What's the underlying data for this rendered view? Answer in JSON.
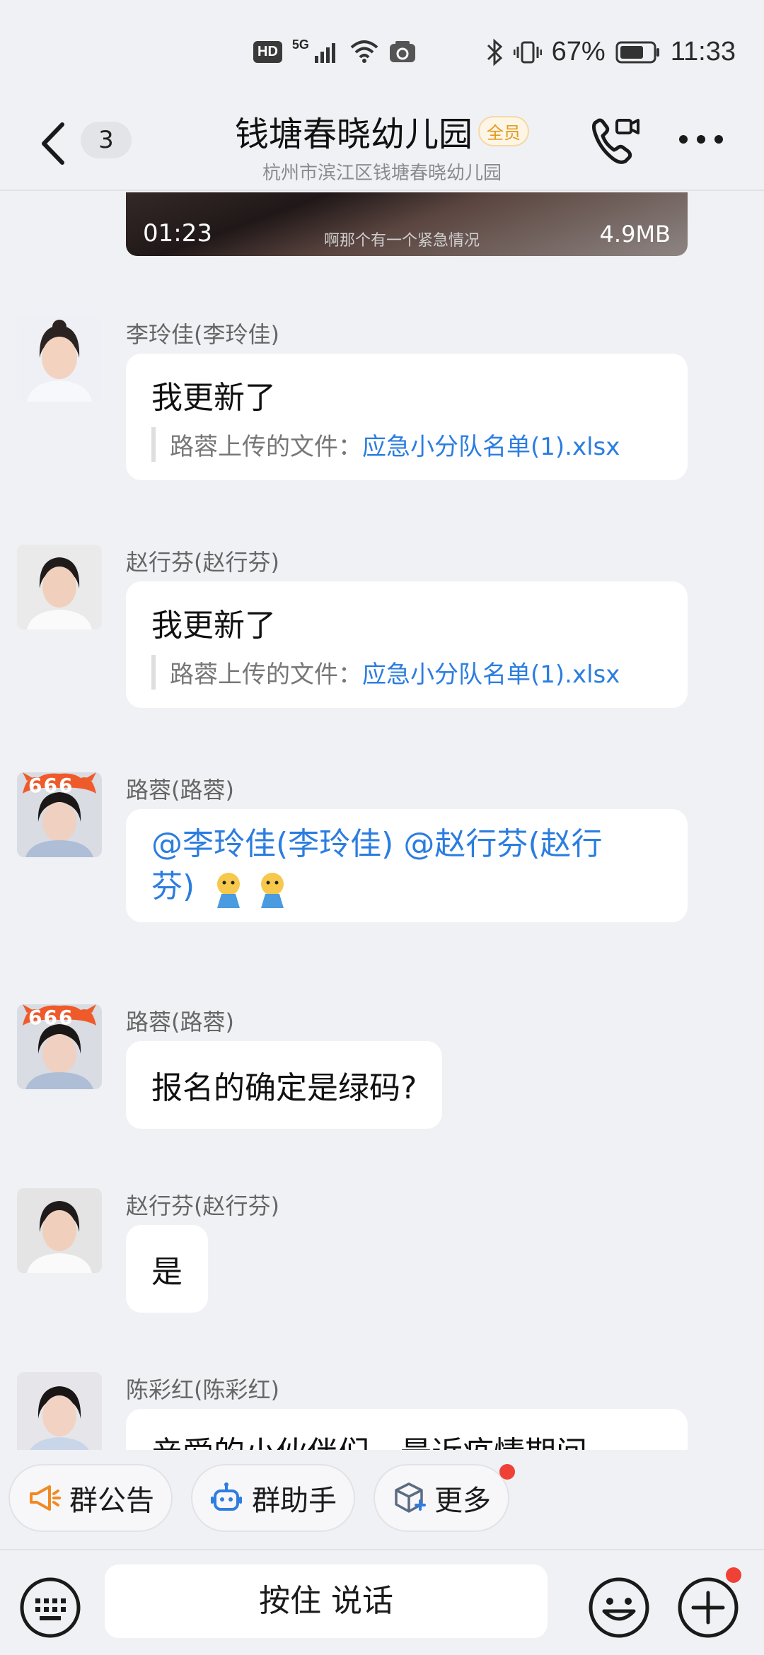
{
  "status_bar": {
    "hd": "HD",
    "network": "5G",
    "battery": "67%",
    "time": "11:33"
  },
  "header": {
    "unread_count": "3",
    "title": "钱塘春晓幼儿园",
    "badge": "全员",
    "subtitle": "杭州市滨江区钱塘春晓幼儿园"
  },
  "video": {
    "duration": "01:23",
    "size": "4.9MB",
    "caption": "啊那个有一个紧急情况"
  },
  "messages": [
    {
      "sender": "李玲佳(李玲佳)",
      "text": "我更新了",
      "quote_prefix": "路蓉上传的文件：",
      "quote_file": "应急小分队名单(1).xlsx"
    },
    {
      "sender": "赵行芬(赵行芬)",
      "text": "我更新了",
      "quote_prefix": "路蓉上传的文件：",
      "quote_file": "应急小分队名单(1).xlsx"
    },
    {
      "sender": "路蓉(路蓉)",
      "mention_line1": "@李玲佳(李玲佳) @赵行芬(赵行",
      "mention_line2": "芬)",
      "avatar_badge": "666"
    },
    {
      "sender": "路蓉(路蓉)",
      "text": "报名的确定是绿码?",
      "avatar_badge": "666"
    },
    {
      "sender": "赵行芬(赵行芬)",
      "text": "是"
    },
    {
      "sender": "陈彩红(陈彩红)",
      "text": "亲爱的小伙伴们，最近疫情期间"
    }
  ],
  "quick_actions": {
    "announcement": "群公告",
    "assistant": "群助手",
    "more": "更多"
  },
  "input_bar": {
    "hold_to_talk": "按住 说话"
  },
  "colors": {
    "background": "#f0f1f4",
    "link": "#2b7de0",
    "badge": "#e39a1c",
    "notification_dot": "#ef4136"
  }
}
